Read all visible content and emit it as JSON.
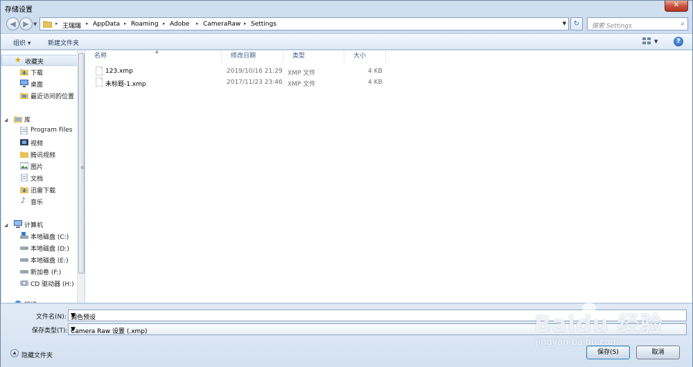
{
  "window": {
    "title": "存储设置",
    "close_glyph": "✕"
  },
  "address": {
    "crumbs": [
      "王瑞瑞",
      "AppData",
      "Roaming",
      "Adobe",
      "CameraRaw",
      "Settings"
    ],
    "search_placeholder": "搜索 Settings"
  },
  "toolbar": {
    "organize": "组织 ▾",
    "new_folder": "新建文件夹",
    "help_glyph": "?"
  },
  "nav": {
    "favorites_label": "收藏夹",
    "favorites": [
      "下载",
      "桌面",
      "最近访问的位置"
    ],
    "libraries_label": "库",
    "libraries": [
      "Program Files",
      "视频",
      "腾讯视频",
      "图片",
      "文档",
      "迅雷下载",
      "音乐"
    ],
    "computer_label": "计算机",
    "drives": [
      "本地磁盘 (C:)",
      "本地磁盘 (D:)",
      "本地磁盘 (E:)",
      "新加卷 (F:)",
      "CD 驱动器 (H:)"
    ],
    "network_label": "网络"
  },
  "columns": {
    "name": "名称",
    "date": "修改日期",
    "type": "类型",
    "size": "大小"
  },
  "files": [
    {
      "name": "123.xmp",
      "date": "2019/10/16 21:29",
      "type": "XMP 文件",
      "size": "4 KB"
    },
    {
      "name": "未标题-1.xmp",
      "date": "2017/11/23 23:46",
      "type": "XMP 文件",
      "size": "4 KB"
    }
  ],
  "form": {
    "filename_label": "文件名(N):",
    "filename_value": "调色预设",
    "filetype_label": "保存类型(T):",
    "filetype_value": "Camera Raw 设置 (.xmp)"
  },
  "footer": {
    "hide_folders": "隐藏文件夹",
    "save": "保存(S)",
    "cancel": "取消"
  },
  "watermark": {
    "brand": "Baidu 经验",
    "url": "jingyan.baidu.com"
  }
}
